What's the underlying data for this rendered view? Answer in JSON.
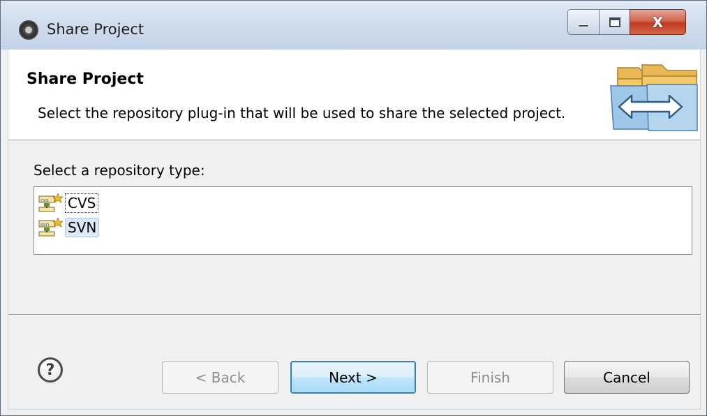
{
  "window": {
    "title": "Share Project",
    "controls": {
      "minimize_icon": "minimize-icon",
      "maximize_icon": "maximize-icon",
      "close_icon": "close-icon",
      "close_glyph": "X"
    }
  },
  "banner": {
    "title": "Share Project",
    "description": "Select the repository plug-in that will be used to share the selected project.",
    "icon": "share-folders-icon"
  },
  "repository": {
    "label": "Select a repository type:",
    "items": [
      {
        "label": "CVS",
        "icon": "cvs-repository-icon",
        "focused": true,
        "selected": false
      },
      {
        "label": "SVN",
        "icon": "svn-repository-icon",
        "focused": false,
        "selected": true
      }
    ]
  },
  "buttons": {
    "help_glyph": "?",
    "back": "< Back",
    "next": "Next >",
    "finish": "Finish",
    "cancel": "Cancel",
    "back_enabled": false,
    "next_enabled": true,
    "finish_enabled": false,
    "cancel_enabled": true
  },
  "colors": {
    "selection_bg": "#dbe9fb",
    "default_button_border": "#3c7fb1",
    "close_button": "#c2391f"
  }
}
